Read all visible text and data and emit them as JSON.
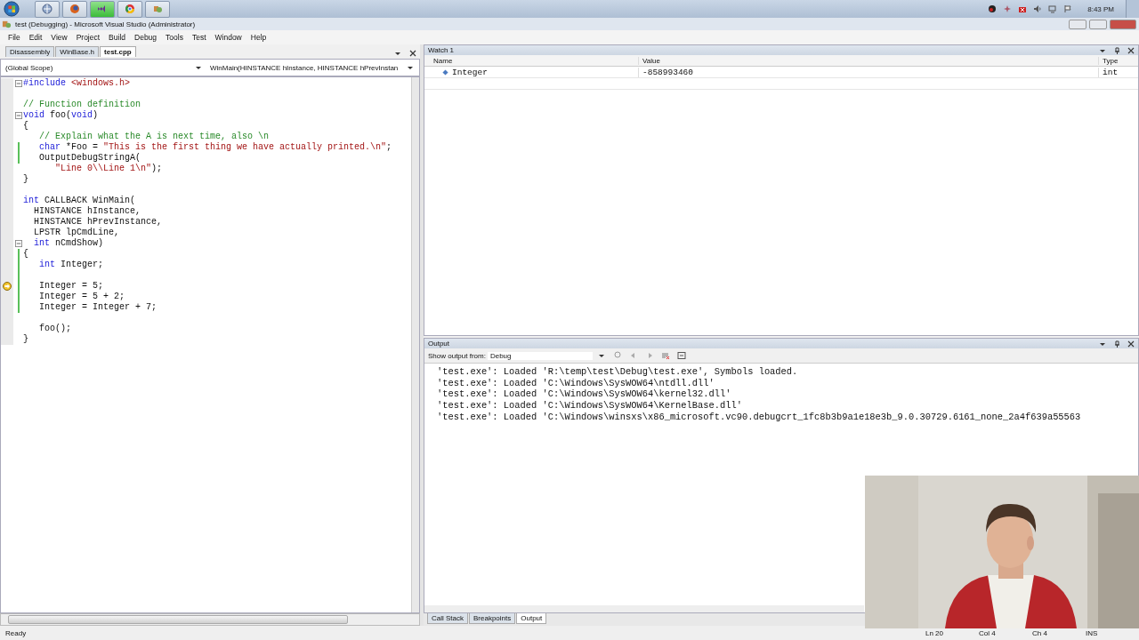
{
  "taskbar": {
    "apps": [
      {
        "kind": "globe",
        "selected": false
      },
      {
        "kind": "fox",
        "selected": false
      },
      {
        "kind": "vs",
        "selected": true
      },
      {
        "kind": "wheel",
        "selected": false
      },
      {
        "kind": "tools",
        "selected": false
      }
    ],
    "clock": "8:43 PM"
  },
  "window": {
    "title": "test (Debugging) - Microsoft Visual Studio (Administrator)"
  },
  "menu": [
    "File",
    "Edit",
    "View",
    "Project",
    "Build",
    "Debug",
    "Tools",
    "Test",
    "Window",
    "Help"
  ],
  "doc_tabs": [
    {
      "label": "Disassembly",
      "selected": false
    },
    {
      "label": "WinBase.h",
      "selected": false
    },
    {
      "label": "test.cpp",
      "selected": true
    }
  ],
  "scope": "(Global Scope)",
  "member": "WinMain(HINSTANCE hInstance, HINSTANCE hPrevInstan",
  "code": [
    {
      "segs": [
        {
          "kind": "kw",
          "text": "#include"
        },
        {
          "kind": "str",
          "text": " <windows.h>"
        }
      ],
      "fold": true,
      "changed": false,
      "current": false
    },
    {
      "fold": false,
      "changed": false,
      "current": false
    },
    {
      "segs": [
        {
          "kind": "com",
          "text": "// Function definition"
        }
      ],
      "fold": false,
      "changed": false,
      "current": false
    },
    {
      "segs": [
        {
          "kind": "kw",
          "text": "void"
        },
        {
          "kind": "txt",
          "text": " foo("
        },
        {
          "kind": "kw",
          "text": "void"
        },
        {
          "kind": "txt",
          "text": ")"
        }
      ],
      "fold": true,
      "changed": false,
      "current": false
    },
    {
      "segs": [
        {
          "kind": "txt",
          "text": "{"
        }
      ],
      "fold": false,
      "changed": false,
      "current": false
    },
    {
      "segs": [
        {
          "kind": "com",
          "text": "   // Explain what the A is next time, also \\n"
        }
      ],
      "fold": false,
      "changed": false,
      "current": false
    },
    {
      "segs": [
        {
          "kind": "kw",
          "text": "   char"
        },
        {
          "kind": "txt",
          "text": " *Foo = "
        },
        {
          "kind": "str",
          "text": "\"This is the first thing we have actually printed.\\n\""
        },
        {
          "kind": "txt",
          "text": ";"
        }
      ],
      "fold": false,
      "changed": true,
      "current": false
    },
    {
      "segs": [
        {
          "kind": "txt",
          "text": "   OutputDebugStringA("
        }
      ],
      "fold": false,
      "changed": true,
      "current": false
    },
    {
      "segs": [
        {
          "kind": "str",
          "text": "      \"Line 0\\\\Line 1\\n\""
        },
        {
          "kind": "txt",
          "text": ");"
        }
      ],
      "fold": false,
      "changed": false,
      "current": false
    },
    {
      "segs": [
        {
          "kind": "txt",
          "text": "}"
        }
      ],
      "fold": false,
      "changed": false,
      "current": false
    },
    {
      "fold": false,
      "changed": false,
      "current": false
    },
    {
      "segs": [
        {
          "kind": "kw",
          "text": "int"
        },
        {
          "kind": "txt",
          "text": " CALLBACK WinMain("
        }
      ],
      "fold": false,
      "changed": false,
      "current": false
    },
    {
      "segs": [
        {
          "kind": "txt",
          "text": "  HINSTANCE hInstance,"
        }
      ],
      "fold": false,
      "changed": false,
      "current": false
    },
    {
      "segs": [
        {
          "kind": "txt",
          "text": "  HINSTANCE hPrevInstance,"
        }
      ],
      "fold": false,
      "changed": false,
      "current": false
    },
    {
      "segs": [
        {
          "kind": "txt",
          "text": "  LPSTR lpCmdLine,"
        }
      ],
      "fold": false,
      "changed": false,
      "current": false
    },
    {
      "segs": [
        {
          "kind": "kw",
          "text": "  int"
        },
        {
          "kind": "txt",
          "text": " nCmdShow)"
        }
      ],
      "fold": true,
      "changed": false,
      "current": false
    },
    {
      "segs": [
        {
          "kind": "txt",
          "text": "{"
        }
      ],
      "fold": false,
      "changed": true,
      "current": false
    },
    {
      "segs": [
        {
          "kind": "kw",
          "text": "   int"
        },
        {
          "kind": "txt",
          "text": " Integer;"
        }
      ],
      "fold": false,
      "changed": true,
      "current": false
    },
    {
      "fold": false,
      "changed": true,
      "current": false
    },
    {
      "segs": [
        {
          "kind": "txt",
          "text": "   Integer = 5;"
        }
      ],
      "fold": false,
      "changed": true,
      "current": true
    },
    {
      "segs": [
        {
          "kind": "txt",
          "text": "   Integer = 5 + 2;"
        }
      ],
      "fold": false,
      "changed": true,
      "current": false
    },
    {
      "segs": [
        {
          "kind": "txt",
          "text": "   Integer = Integer + 7;"
        }
      ],
      "fold": false,
      "changed": true,
      "current": false
    },
    {
      "fold": false,
      "changed": false,
      "current": false
    },
    {
      "segs": [
        {
          "kind": "txt",
          "text": "   foo();"
        }
      ],
      "fold": false,
      "changed": false,
      "current": false
    },
    {
      "segs": [
        {
          "kind": "txt",
          "text": "}"
        }
      ],
      "fold": false,
      "changed": false,
      "current": false
    }
  ],
  "watch": {
    "title": "Watch 1",
    "columns": [
      "Name",
      "Value",
      "Type"
    ],
    "rows": [
      {
        "name": "Integer",
        "value": "-858993460",
        "type": "int"
      }
    ]
  },
  "output": {
    "title": "Output",
    "source_label": "Show output from:",
    "source": "Debug",
    "lines": [
      "'test.exe': Loaded 'R:\\temp\\test\\Debug\\test.exe', Symbols loaded.",
      "'test.exe': Loaded 'C:\\Windows\\SysWOW64\\ntdll.dll'",
      "'test.exe': Loaded 'C:\\Windows\\SysWOW64\\kernel32.dll'",
      "'test.exe': Loaded 'C:\\Windows\\SysWOW64\\KernelBase.dll'",
      "'test.exe': Loaded 'C:\\Windows\\winsxs\\x86_microsoft.vc90.debugcrt_1fc8b3b9a1e18e3b_9.0.30729.6161_none_2a4f639a55563"
    ]
  },
  "bottom_tabs": [
    {
      "label": "Call Stack",
      "selected": false
    },
    {
      "label": "Breakpoints",
      "selected": false
    },
    {
      "label": "Output",
      "selected": true
    }
  ],
  "status": {
    "text": "Ready",
    "line": "Ln 20",
    "col": "Col 4",
    "ch": "Ch 4",
    "mode": "INS"
  }
}
